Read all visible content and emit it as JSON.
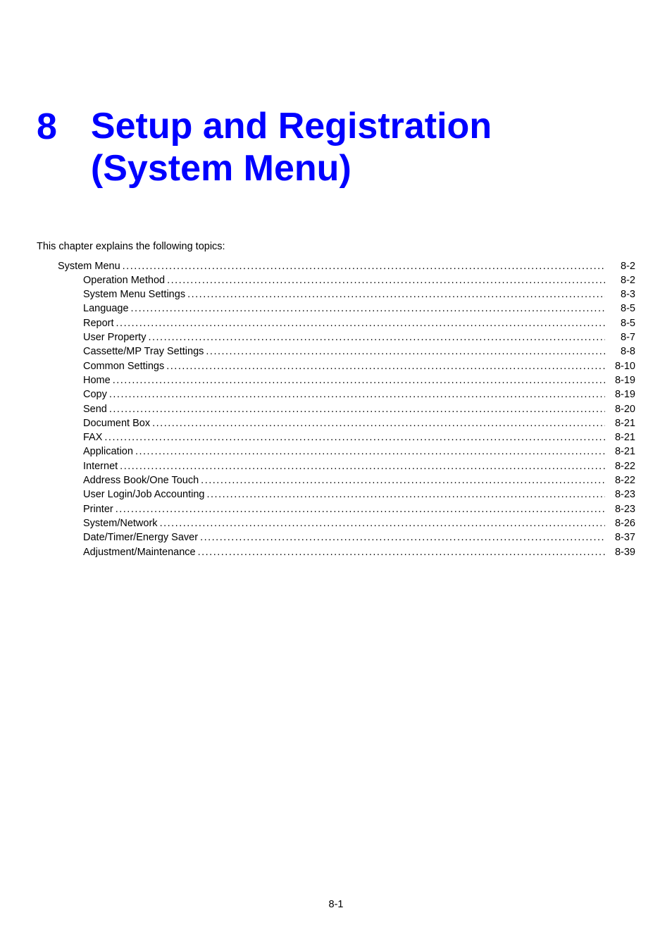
{
  "chapter": {
    "number": "8",
    "title_line1": "Setup and Registration",
    "title_line2": "(System Menu)"
  },
  "intro": "This chapter explains the following topics:",
  "toc": [
    {
      "level": 1,
      "label": "System Menu",
      "page": "8-2"
    },
    {
      "level": 2,
      "label": "Operation Method",
      "page": "8-2"
    },
    {
      "level": 2,
      "label": "System Menu Settings",
      "page": "8-3"
    },
    {
      "level": 2,
      "label": "Language",
      "page": "8-5"
    },
    {
      "level": 2,
      "label": "Report",
      "page": "8-5"
    },
    {
      "level": 2,
      "label": "User Property",
      "page": "8-7"
    },
    {
      "level": 2,
      "label": "Cassette/MP Tray Settings",
      "page": "8-8"
    },
    {
      "level": 2,
      "label": "Common Settings",
      "page": "8-10"
    },
    {
      "level": 2,
      "label": "Home",
      "page": "8-19"
    },
    {
      "level": 2,
      "label": "Copy",
      "page": "8-19"
    },
    {
      "level": 2,
      "label": "Send",
      "page": "8-20"
    },
    {
      "level": 2,
      "label": "Document Box",
      "page": "8-21"
    },
    {
      "level": 2,
      "label": "FAX",
      "page": "8-21"
    },
    {
      "level": 2,
      "label": "Application",
      "page": "8-21"
    },
    {
      "level": 2,
      "label": "Internet",
      "page": "8-22"
    },
    {
      "level": 2,
      "label": "Address Book/One Touch",
      "page": "8-22"
    },
    {
      "level": 2,
      "label": "User Login/Job Accounting",
      "page": "8-23"
    },
    {
      "level": 2,
      "label": "Printer",
      "page": "8-23"
    },
    {
      "level": 2,
      "label": "System/Network",
      "page": "8-26"
    },
    {
      "level": 2,
      "label": "Date/Timer/Energy Saver",
      "page": "8-37"
    },
    {
      "level": 2,
      "label": "Adjustment/Maintenance",
      "page": "8-39"
    }
  ],
  "page_number": "8-1"
}
